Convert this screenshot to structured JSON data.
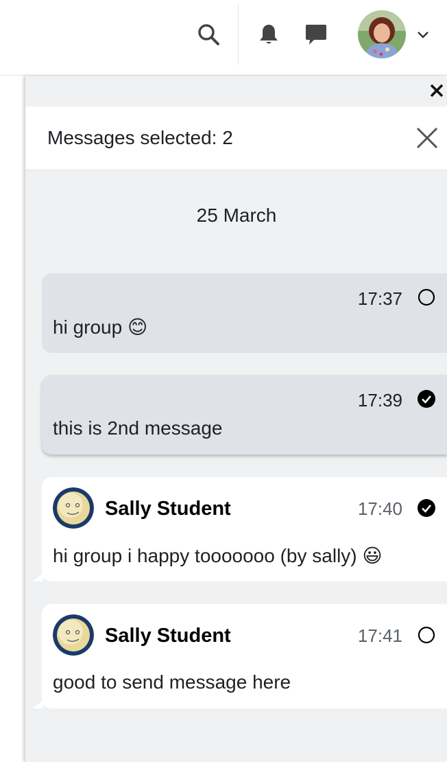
{
  "navbar": {
    "search_icon": "search-icon",
    "notifications_icon": "bell-icon",
    "messages_icon": "chat-bubble-icon",
    "user_menu_icon": "chevron-down-icon"
  },
  "drawer": {
    "close_icon": "close-icon",
    "selection": {
      "text": "Messages selected: 2",
      "close_icon": "close-icon"
    },
    "date": "25 March",
    "messages": [
      {
        "time": "17:37",
        "text": "hi group 😊",
        "selected": false,
        "own": true
      },
      {
        "time": "17:39",
        "text": "this is 2nd message",
        "selected": true,
        "own": true
      },
      {
        "sender": "Sally Student",
        "time": "17:40",
        "text": "hi group i happy tooooooo (by sally) 😃",
        "selected": true,
        "own": false
      },
      {
        "sender": "Sally Student",
        "time": "17:41",
        "text": "good to send message here",
        "selected": false,
        "own": false
      }
    ]
  },
  "colors": {
    "drawer_bg": "#eff1f3",
    "own_bubble": "#dfe2e6",
    "other_bubble": "#ffffff",
    "avatar_ring": "#1a3a6b"
  }
}
